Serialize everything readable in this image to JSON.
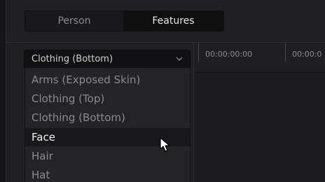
{
  "tabs": {
    "person": "Person",
    "features": "Features"
  },
  "dropdown": {
    "selected": "Clothing (Bottom)"
  },
  "menu": {
    "items": [
      "Arms (Exposed Skin)",
      "Clothing (Top)",
      "Clothing (Bottom)",
      "Face",
      "Hair",
      "Hat"
    ],
    "hovered_item": "Face"
  },
  "timeline": {
    "timecodes": [
      "00:00:00:00",
      "00:00:0"
    ]
  },
  "colors": {
    "background": "#1b1b1d",
    "panel": "#202022",
    "active_tab": "#0f0f10",
    "hover_row": "#18181a",
    "text_active": "#f2f2f2",
    "text_muted": "#8b8b8d"
  },
  "icons": {
    "dropdown": "chevron-down-icon",
    "pointer": "mouse-pointer-icon"
  }
}
